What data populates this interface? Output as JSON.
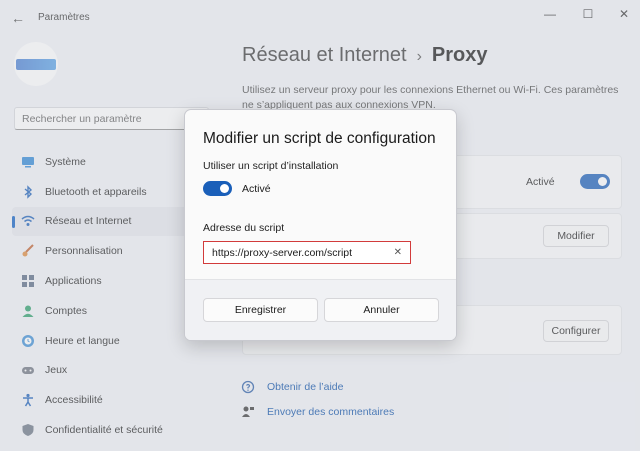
{
  "window": {
    "title": "Paramètres",
    "back_icon": "←",
    "minimize_icon": "—",
    "maximize_icon": "☐",
    "close_icon": "✕"
  },
  "sidebar": {
    "search_placeholder": "Rechercher un paramètre",
    "items": [
      {
        "label": "Système",
        "icon": "monitor-icon",
        "active": false
      },
      {
        "label": "Bluetooth et appareils",
        "icon": "bluetooth-icon",
        "active": false
      },
      {
        "label": "Réseau et Internet",
        "icon": "wifi-icon",
        "active": true
      },
      {
        "label": "Personnalisation",
        "icon": "brush-icon",
        "active": false
      },
      {
        "label": "Applications",
        "icon": "apps-icon",
        "active": false
      },
      {
        "label": "Comptes",
        "icon": "person-icon",
        "active": false
      },
      {
        "label": "Heure et langue",
        "icon": "globe-clock-icon",
        "active": false
      },
      {
        "label": "Jeux",
        "icon": "gamepad-icon",
        "active": false
      },
      {
        "label": "Accessibilité",
        "icon": "accessibility-icon",
        "active": false
      },
      {
        "label": "Confidentialité et sécurité",
        "icon": "shield-icon",
        "active": false
      }
    ]
  },
  "main": {
    "breadcrumb_parent": "Réseau et Internet",
    "breadcrumb_separator": "›",
    "breadcrumb_current": "Proxy",
    "description": "Utilisez un serveur proxy pour les connexions Ethernet ou Wi-Fi. Ces paramètres ne s’appliquent pas aux connexions VPN.",
    "auto_detect_state": "Activé",
    "modify_button": "Modifier",
    "configure_button": "Configurer",
    "help_link": "Obtenir de l’aide",
    "feedback_link": "Envoyer des commentaires"
  },
  "dialog": {
    "title": "Modifier un script de configuration",
    "use_script_label": "Utiliser un script d’installation",
    "toggle_state": "Activé",
    "address_label": "Adresse du script",
    "address_value": "https://proxy-server.com/script",
    "clear_icon": "✕",
    "save_button": "Enregistrer",
    "cancel_button": "Annuler"
  },
  "colors": {
    "accent": "#1a5fb9",
    "highlight_border": "#d23b3b",
    "link": "#0a4fa8"
  }
}
